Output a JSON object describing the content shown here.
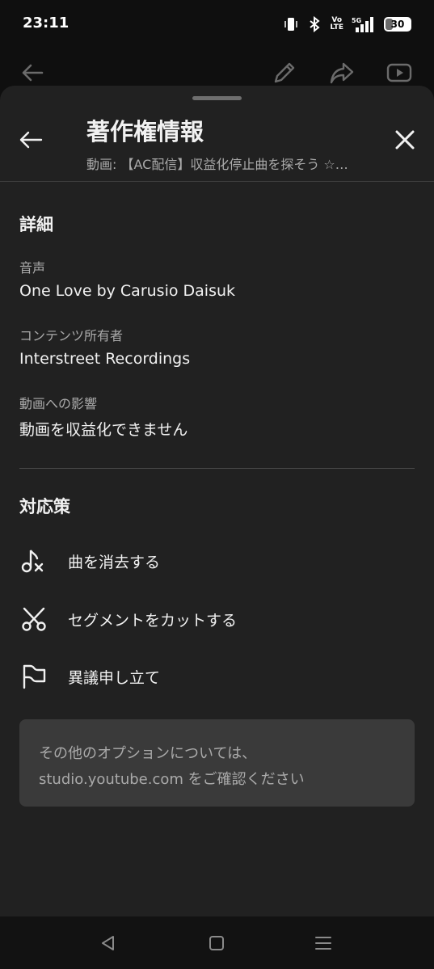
{
  "status_bar": {
    "time": "23:11",
    "network_label": "Vo\nLTE",
    "signal_label": "5G",
    "battery_level": "30"
  },
  "background_appbar": {
    "icons": [
      "back-arrow-icon",
      "edit-pencil-icon",
      "share-icon",
      "youtube-icon"
    ]
  },
  "sheet": {
    "title": "著作権情報",
    "subtitle": "動画: 【AC配信】収益化停止曲を探そう ☆…",
    "details": {
      "heading": "詳細",
      "fields": [
        {
          "label": "音声",
          "value": "One Love by Carusio Daisuk"
        },
        {
          "label": "コンテンツ所有者",
          "value": "Interstreet Recordings"
        },
        {
          "label": "動画への影響",
          "value": "動画を収益化できません"
        }
      ]
    },
    "actions": {
      "heading": "対応策",
      "items": [
        {
          "label": "曲を消去する",
          "icon": "music-note-remove-icon"
        },
        {
          "label": "セグメントをカットする",
          "icon": "scissors-icon"
        },
        {
          "label": "異議申し立て",
          "icon": "flag-icon"
        }
      ]
    },
    "info": {
      "line1": "その他のオプションについては、",
      "line2": "studio.youtube.com をご確認ください"
    }
  },
  "colors": {
    "page_background": "#0f0f0f",
    "sheet_background": "#212121",
    "info_box_background": "#3a3a3a",
    "primary_text": "#f1f1f1",
    "secondary_text": "#aaaaaa"
  }
}
